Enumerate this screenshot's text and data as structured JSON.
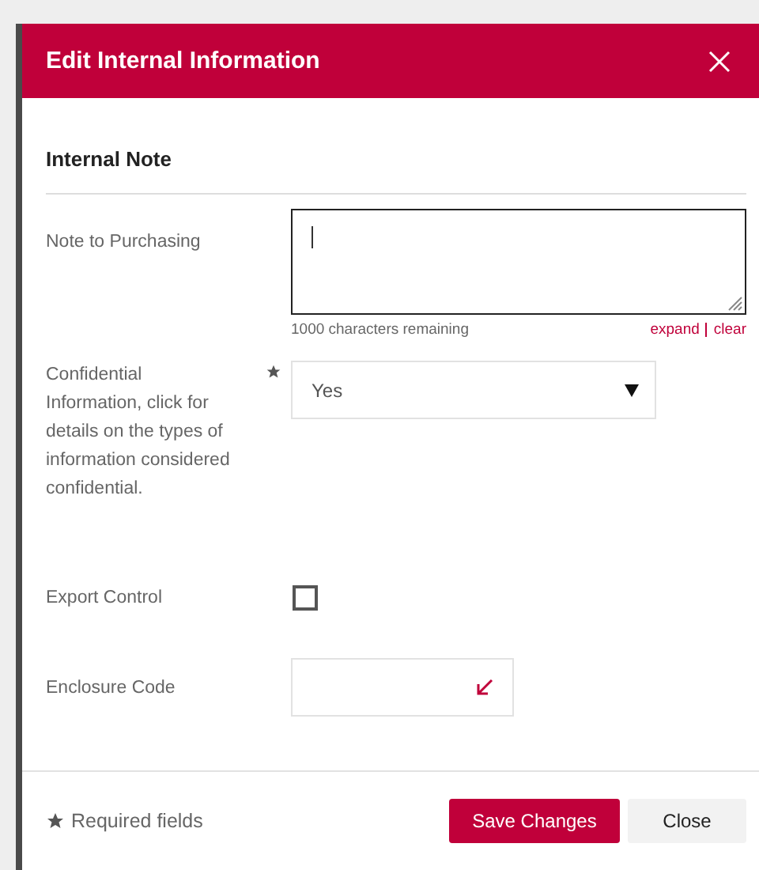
{
  "dialog": {
    "title": "Edit Internal Information"
  },
  "section": {
    "title": "Internal Note"
  },
  "fields": [
    {
      "kind": "textarea",
      "label": "Note to Purchasing",
      "required": false,
      "focused": true,
      "counter": "1000 characters remaining",
      "links": [
        "expand",
        "clear"
      ]
    },
    {
      "kind": "select",
      "label": "Confidential Information, click for details on the types of information considered confidential.",
      "required": true,
      "value": "Yes"
    },
    {
      "kind": "checkbox",
      "label": "Export Control",
      "required": false,
      "checked": false
    },
    {
      "kind": "lookup",
      "label": "Enclosure Code",
      "required": false
    }
  ],
  "footer": {
    "required_note": "Required fields",
    "buttons": [
      {
        "label": "Save Changes",
        "kind": "primary"
      },
      {
        "label": "Close",
        "kind": "secondary"
      }
    ]
  }
}
